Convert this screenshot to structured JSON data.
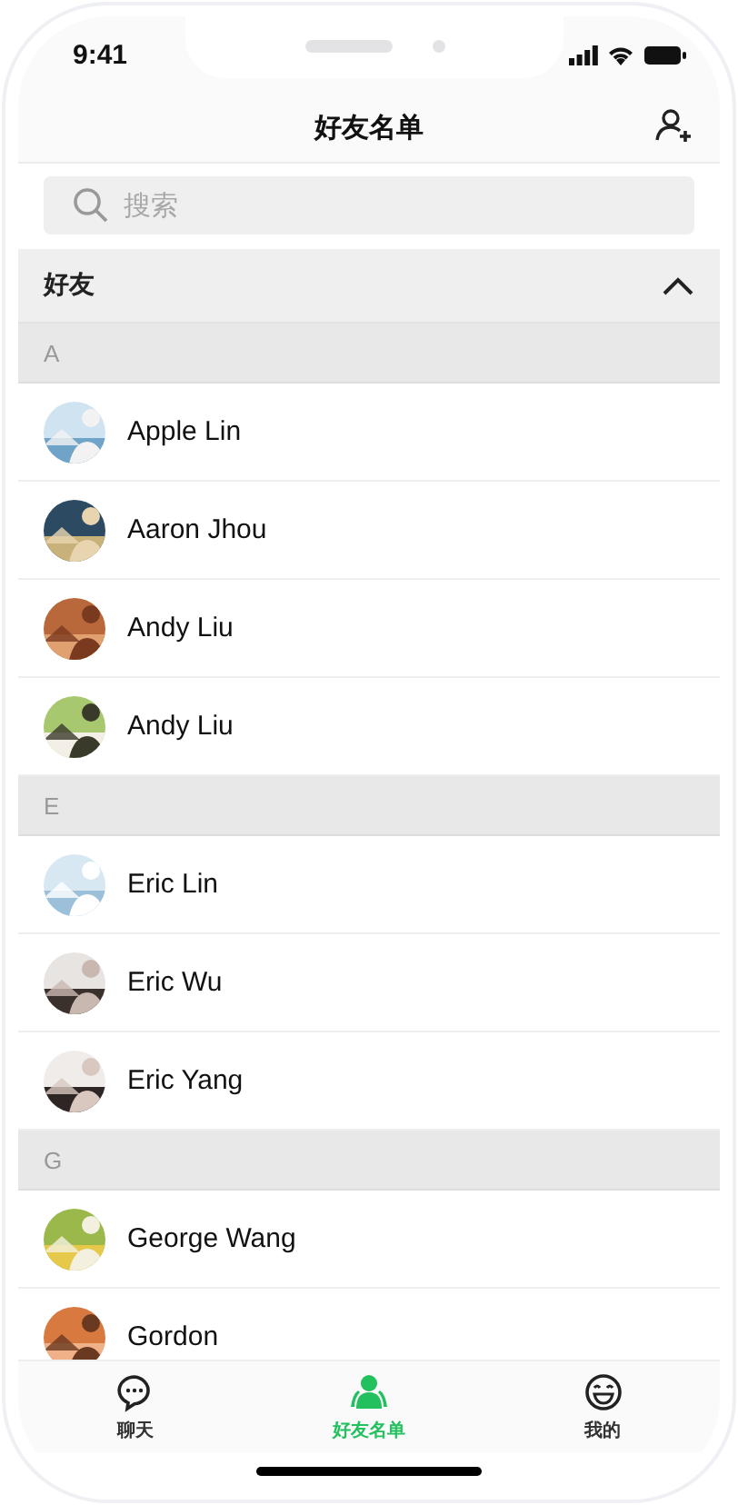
{
  "status_bar": {
    "time": "9:41"
  },
  "nav_bar": {
    "title": "好友名单"
  },
  "search": {
    "placeholder": "搜索"
  },
  "group": {
    "title": "好友",
    "expanded": true
  },
  "sections": [
    {
      "letter": "A",
      "contacts": [
        {
          "name": "Apple Lin"
        },
        {
          "name": "Aaron Jhou"
        },
        {
          "name": "Andy Liu"
        },
        {
          "name": "Andy Liu"
        }
      ]
    },
    {
      "letter": "E",
      "contacts": [
        {
          "name": "Eric Lin"
        },
        {
          "name": "Eric Wu"
        },
        {
          "name": "Eric Yang"
        }
      ]
    },
    {
      "letter": "G",
      "contacts": [
        {
          "name": "George Wang"
        },
        {
          "name": "Gordon"
        }
      ]
    }
  ],
  "tab_bar": [
    {
      "kind": "chat",
      "label": "聊天",
      "selected": false
    },
    {
      "kind": "contacts",
      "label": "好友名单",
      "selected": true
    },
    {
      "kind": "me",
      "label": "我的",
      "selected": false
    }
  ]
}
